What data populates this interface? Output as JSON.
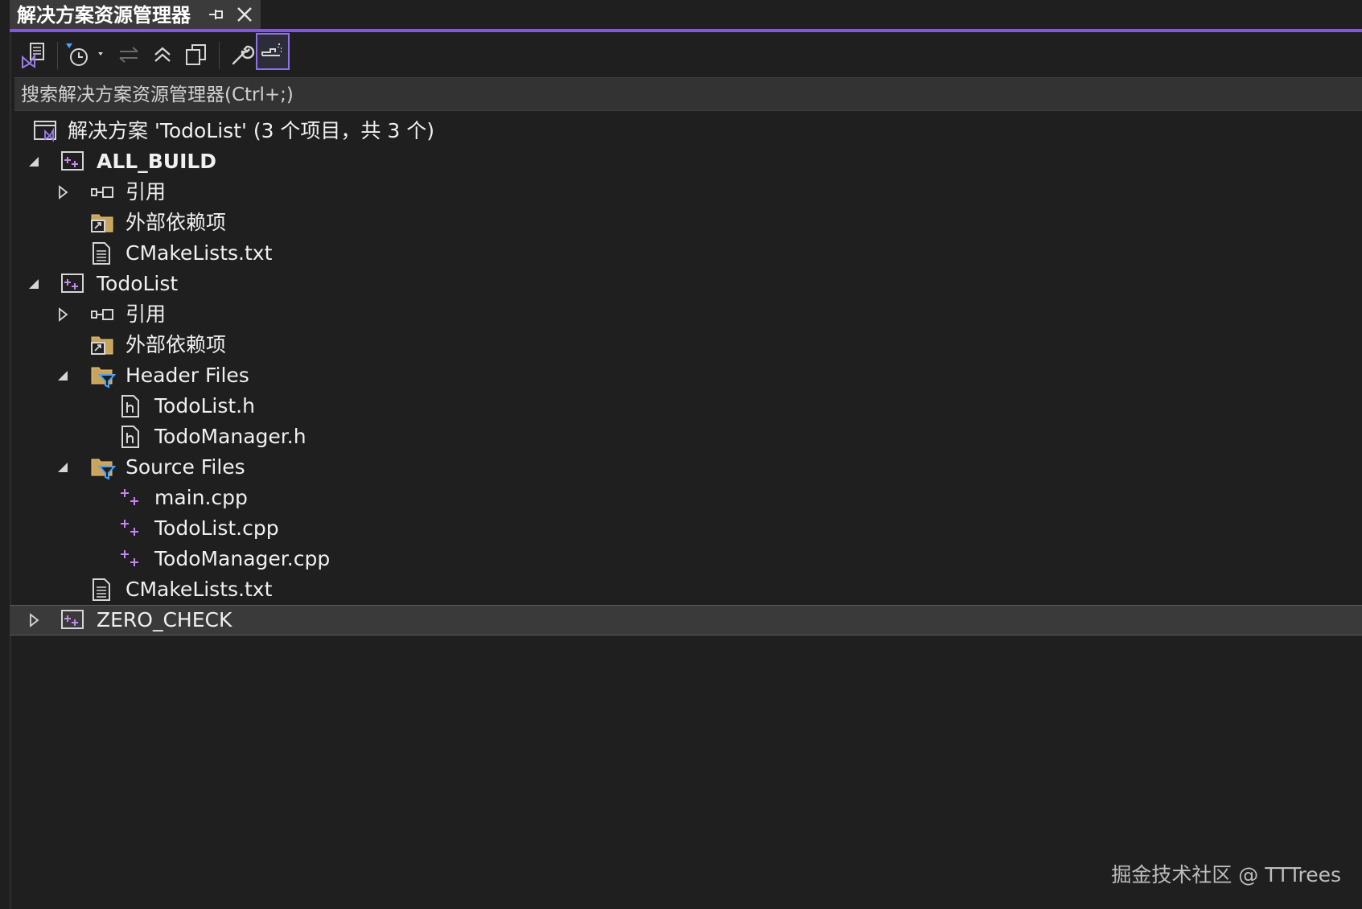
{
  "window": {
    "title": "解决方案资源管理器",
    "pin_glyph": "⊣",
    "accent_color": "#7f5cd6"
  },
  "toolbar": {
    "buttons": [
      {
        "name": "switch-views",
        "icon": "vs-solution-icon"
      },
      {
        "name": "pending-changes-filter",
        "icon": "history-icon"
      },
      {
        "name": "sync-active-document",
        "icon": "sync-arrows-icon"
      },
      {
        "name": "collapse-all",
        "icon": "collapse-all-icon"
      },
      {
        "name": "show-all-files",
        "icon": "copy-files-icon"
      },
      {
        "name": "properties",
        "icon": "wrench-icon"
      },
      {
        "name": "preview-selected-items",
        "icon": "preview-icon"
      }
    ]
  },
  "search": {
    "placeholder": "搜索解决方案资源管理器(Ctrl+;)"
  },
  "tree": {
    "solution": "解决方案 'TodoList' (3 个项目，共 3 个)",
    "all_build": {
      "name": "ALL_BUILD",
      "references": "引用",
      "external_deps": "外部依赖项",
      "cmakelists": "CMakeLists.txt"
    },
    "todolist": {
      "name": "TodoList",
      "references": "引用",
      "external_deps": "外部依赖项",
      "header_files": "Header Files",
      "headers": [
        "TodoList.h",
        "TodoManager.h"
      ],
      "source_files": "Source Files",
      "sources": [
        "main.cpp",
        "TodoList.cpp",
        "TodoManager.cpp"
      ],
      "cmakelists": "CMakeLists.txt"
    },
    "zero_check": {
      "name": "ZERO_CHECK"
    }
  },
  "watermark": "掘金技术社区 @ TTTrees"
}
